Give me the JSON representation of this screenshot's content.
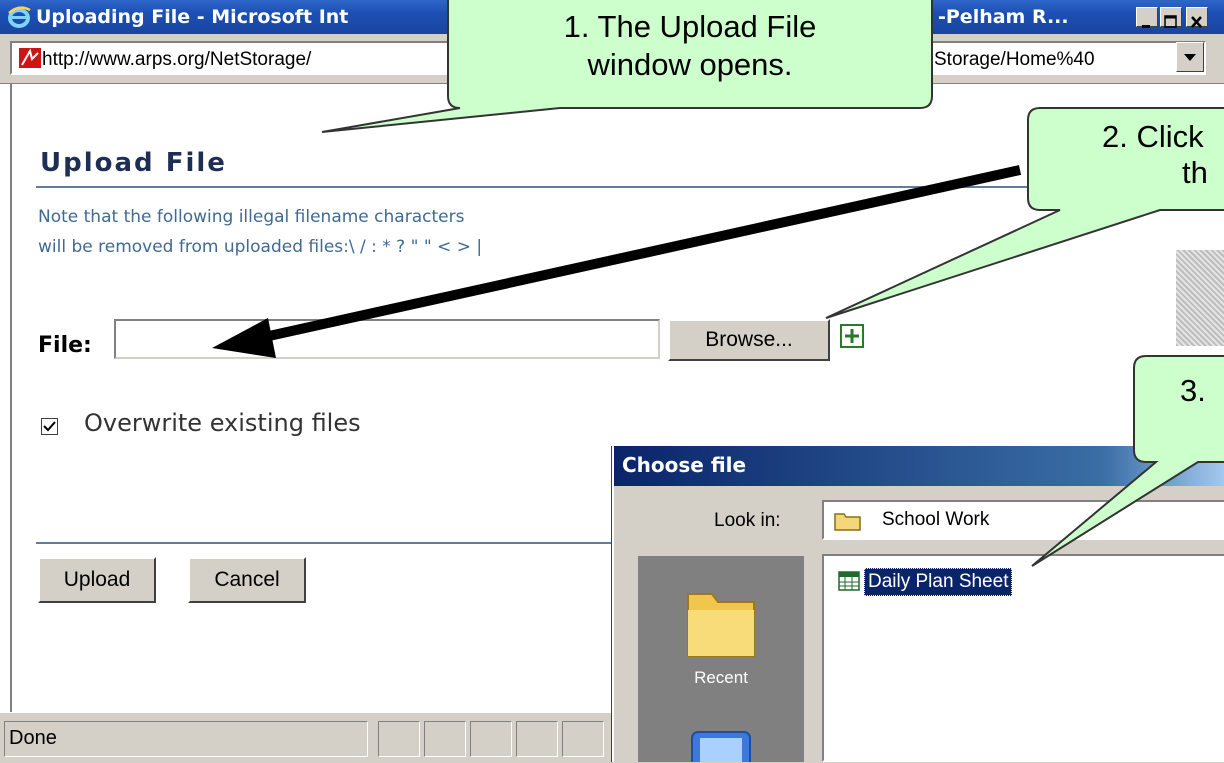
{
  "window": {
    "title_left": "Uploading File - Microsoft Int",
    "title_right": "-Pelham R...",
    "address_left": "http://www.arps.org/NetStorage/",
    "address_right": "Storage/Home%40"
  },
  "page": {
    "heading": "Upload File",
    "note_line1": "Note that the following illegal filename characters",
    "note_line2": "will be removed from uploaded files:\\ / : * ? \" \" < > |",
    "file_label": "File:",
    "file_value": "",
    "browse_label": "Browse...",
    "overwrite_label": "Overwrite existing files",
    "overwrite_checked": true,
    "upload_label": "Upload",
    "cancel_label": "Cancel"
  },
  "statusbar": {
    "text": "Done"
  },
  "dialog": {
    "title": "Choose file",
    "lookin_label": "Look in:",
    "lookin_value": "School Work",
    "file_item": "Daily Plan Sheet",
    "recent_label": "Recent"
  },
  "callouts": {
    "c1_line1": "1. The Upload File",
    "c1_line2": "window opens.",
    "c2_line1": "2. Click",
    "c2_line2": "th",
    "c3_line1": "3."
  },
  "colors": {
    "titlebar": "#1d4fb3",
    "callout_fill": "#ccffcc",
    "heading_color": "#1e2f56",
    "note_color": "#3f6a93",
    "dialog_title": "#0a246a"
  }
}
